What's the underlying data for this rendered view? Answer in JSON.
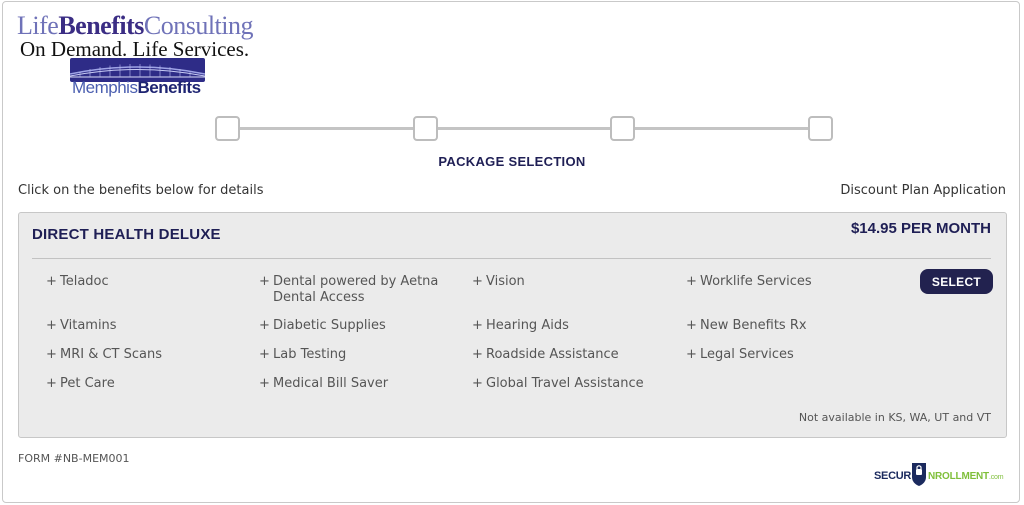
{
  "logo": {
    "line1_a": "Life",
    "line1_b": "Benefits",
    "line1_c": "Consulting",
    "line2": "On Demand. Life Services.",
    "line3_a": "Memphis",
    "line3_b": "Benefits",
    "tagline": "POWERED BY LifeBenefits"
  },
  "stepper": {
    "steps": 4,
    "current_title": "PACKAGE SELECTION"
  },
  "instruction": "Click on the benefits below for details",
  "plan_type": "Discount Plan Application",
  "package": {
    "name": "DIRECT HEALTH DELUXE",
    "price": "$14.95 PER MONTH",
    "select_label": "SELECT",
    "benefits": [
      [
        "Teladoc",
        "Dental powered by Aetna Dental Access",
        "Vision",
        "Worklife Services"
      ],
      [
        "Vitamins",
        "Diabetic Supplies",
        "Hearing Aids",
        "New Benefits Rx"
      ],
      [
        "MRI & CT Scans",
        "Lab Testing",
        "Roadside Assistance",
        "Legal Services"
      ],
      [
        "Pet Care",
        "Medical Bill Saver",
        "Global Travel Assistance"
      ]
    ],
    "availability_note": "Not available in KS, WA, UT and VT"
  },
  "form_number": "FORM #NB-MEM001",
  "secure_badge": {
    "left": "SECUR",
    "right": "NROLLMENT",
    "domain": ".com"
  },
  "colors": {
    "navy": "#1f1f55",
    "panel": "#ebebeb",
    "secure_green": "#7fbf3a"
  }
}
